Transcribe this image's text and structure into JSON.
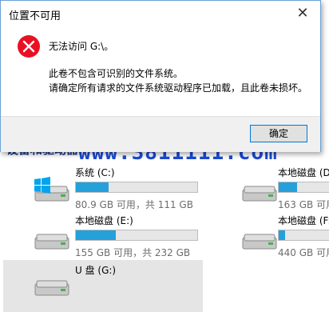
{
  "dialog": {
    "title": "位置不可用",
    "message_main": "无法访问 G:\\。",
    "message_detail_1": "此卷不包含可识别的文件系统。",
    "message_detail_2": "请确定所有请求的文件系统驱动程序已加载，且此卷未损坏。",
    "ok_label": "确定",
    "close_glyph": "✕"
  },
  "explorer": {
    "section_header": "设备和驱动器",
    "watermark": "www.3811111.com",
    "drives": [
      {
        "name": "系统 (C:)",
        "info": "80.9 GB 可用，共 111 GB",
        "used_fraction": 0.27,
        "bar_color": "#26a0da",
        "os_drive": true
      },
      {
        "name": "本地磁盘 (D:)",
        "info": "163 GB 可用",
        "used_fraction": 0.3,
        "bar_color": "#26a0da",
        "os_drive": false
      },
      {
        "name": "本地磁盘 (E:)",
        "info": "155 GB 可用，共 232 GB",
        "used_fraction": 0.33,
        "bar_color": "#26a0da",
        "os_drive": false
      },
      {
        "name": "本地磁盘 (F:)",
        "info": "440 GB 可用",
        "used_fraction": 0.1,
        "bar_color": "#26a0da",
        "os_drive": false
      },
      {
        "name": "U 盘 (G:)",
        "info": "",
        "used_fraction": null,
        "bar_color": "#26a0da",
        "os_drive": false
      }
    ]
  },
  "colors": {
    "accent": "#0078d7",
    "error_red": "#e81123",
    "bar": "#26a0da"
  }
}
